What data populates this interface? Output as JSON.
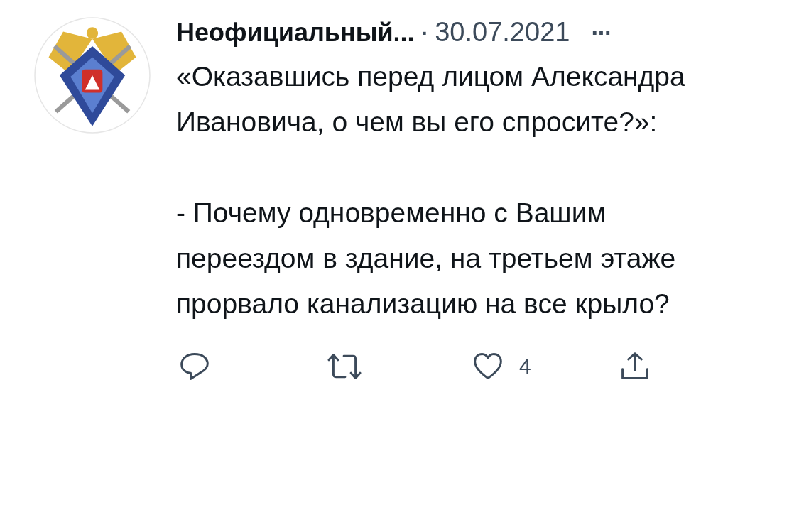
{
  "tweet": {
    "author": "Неофициальный...",
    "separator": "·",
    "date": "30.07.2021",
    "more": "···",
    "paragraphs": [
      "«Оказавшись перед лицом Александра Ивановича, о чем вы его спросите?»:",
      "- Почему одновременно с Вашим переездом в здание, на третьем этаже прорвало канализацию на все крыло?"
    ],
    "actions": [
      {
        "kind": "reply"
      },
      {
        "kind": "retweet"
      },
      {
        "kind": "like",
        "count": "4"
      },
      {
        "kind": "share"
      }
    ]
  }
}
